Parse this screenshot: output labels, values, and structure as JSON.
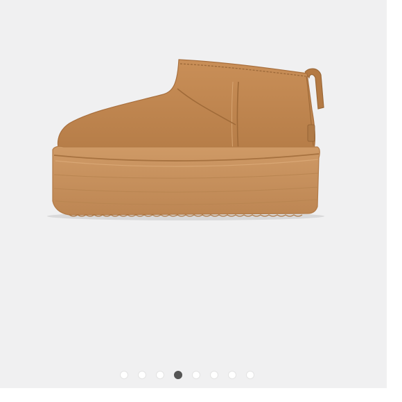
{
  "product": {
    "image_icon": "platform-mini-boot-image",
    "colors": {
      "background": "#f0f0f1",
      "suede": "#c08a55",
      "sole": "#c6915e",
      "fleece": "#f1e4cf"
    }
  },
  "carousel": {
    "total_slides": 8,
    "active_index": 3,
    "dots": [
      {
        "active": false
      },
      {
        "active": false
      },
      {
        "active": false
      },
      {
        "active": true
      },
      {
        "active": false
      },
      {
        "active": false
      },
      {
        "active": false
      },
      {
        "active": false
      }
    ],
    "colors": {
      "dot": "#ffffff",
      "dot_active": "#555555"
    }
  }
}
